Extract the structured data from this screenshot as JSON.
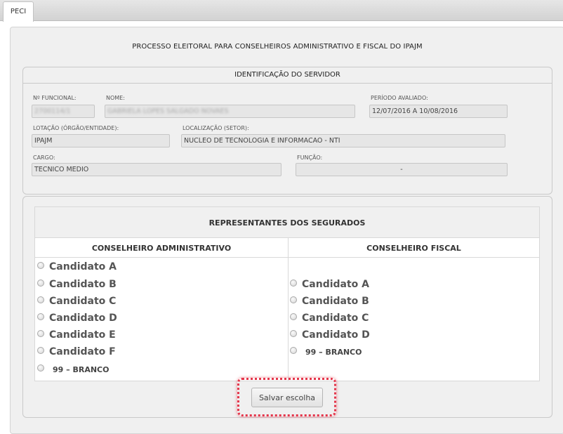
{
  "tab": {
    "label": "PECI"
  },
  "title": "PROCESSO ELEITORAL PARA CONSELHEIROS ADMINISTRATIVO E FISCAL DO IPAJM",
  "servidor": {
    "section_title": "IDENTIFICAÇÃO DO SERVIDOR",
    "n_funcional": {
      "label": "Nº FUNCIONAL:",
      "value": "2700114/1"
    },
    "nome": {
      "label": "NOME:",
      "value": "GABRIELA LOPES SALGADO NOVAES"
    },
    "periodo": {
      "label": "PERÍODO AVALIADO:",
      "value": "12/07/2016 A 10/08/2016"
    },
    "lotacao": {
      "label": "LOTAÇÃO (ÓRGÃO/ENTIDADE):",
      "value": "IPAJM"
    },
    "localizacao": {
      "label": "LOCALIZAÇÃO (SETOR):",
      "value": "NUCLEO DE TECNOLOGIA E INFORMACAO - NTI"
    },
    "cargo": {
      "label": "CARGO:",
      "value": "TECNICO MEDIO"
    },
    "funcao": {
      "label": "FUNÇÃO:",
      "value": "-"
    }
  },
  "representantes": {
    "title": "REPRESENTANTES DOS SEGURADOS",
    "administrativo": {
      "header": "CONSELHEIRO ADMINISTRATIVO",
      "options": [
        "Candidato A",
        "Candidato B",
        "Candidato C",
        "Candidato D",
        "Candidato E",
        "Candidato F",
        "99 – BRANCO"
      ]
    },
    "fiscal": {
      "header": "CONSELHEIRO FISCAL",
      "options": [
        "Candidato A",
        "Candidato B",
        "Candidato C",
        "Candidato D",
        "99 – BRANCO"
      ]
    }
  },
  "save_button": {
    "label": "Salvar escolha"
  },
  "colors": {
    "highlight": "#e4354a",
    "panel_bg": "#f0f0f0",
    "tabbar": "#d8d8d8"
  }
}
